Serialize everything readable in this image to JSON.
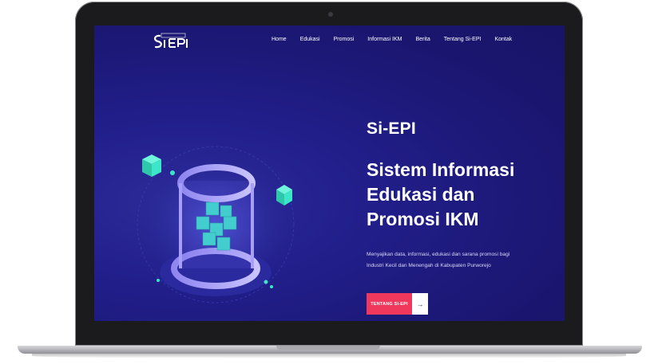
{
  "brand": {
    "logo_text": "SiEPI"
  },
  "nav": {
    "items": [
      "Home",
      "Edukasi",
      "Promosi",
      "Informasi IKM",
      "Berita",
      "Tentang Si-EPI",
      "Kontak"
    ]
  },
  "hero": {
    "tag": "Si-EPI",
    "title_lines": [
      "Sistem Informasi",
      "Edukasi dan",
      "Promosi IKM"
    ],
    "description": "Menyajikan data, informasi, edukasi dan sarana promosi bagi Industri Kecil dan Menengah di Kabupaten Purworejo",
    "cta_label": "TENTANG SI-EPI",
    "cta_icon": "arrow-right-icon"
  },
  "colors": {
    "background": "#211e8a",
    "accent": "#f0375c",
    "cube": "#3ce6c8"
  }
}
